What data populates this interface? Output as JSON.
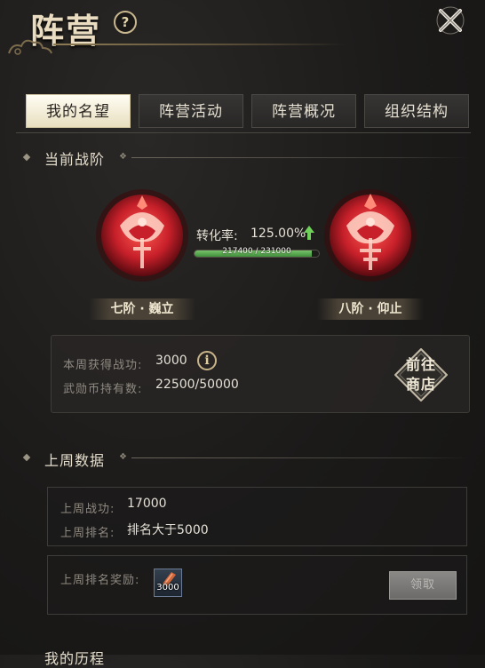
{
  "header": {
    "title": "阵营",
    "help_icon": "question-icon",
    "close_icon": "close-x-icon"
  },
  "tabs": [
    {
      "label": "我的名望",
      "active": true
    },
    {
      "label": "阵营活动",
      "active": false
    },
    {
      "label": "阵营概况",
      "active": false
    },
    {
      "label": "组织结构",
      "active": false
    }
  ],
  "current_rank": {
    "section_title": "当前战阶",
    "current_name": "七阶 · 巍立",
    "next_name": "八阶 · 仰止",
    "conversion_label": "转化率:",
    "conversion_value": "125.00%",
    "progress_text": "217400 / 231000",
    "progress_fraction": 0.941,
    "weekly_merit_label": "本周获得战功:",
    "weekly_merit_value": "3000",
    "coin_label": "武勋币持有数:",
    "coin_value": "22500/50000",
    "shop_button": "前往\n商店",
    "shop_line1": "前往",
    "shop_line2": "商店"
  },
  "last_week": {
    "section_title": "上周数据",
    "merit_label": "上周战功:",
    "merit_value": "17000",
    "rank_label": "上周排名:",
    "rank_value": "排名大于5000",
    "reward_label": "上周排名奖励:",
    "reward_count": "3000",
    "claim_button": "领取"
  },
  "colors": {
    "accent_gold": "#c9b88f",
    "progress_green": "#5fae52",
    "emblem_red": "#c8202a"
  }
}
